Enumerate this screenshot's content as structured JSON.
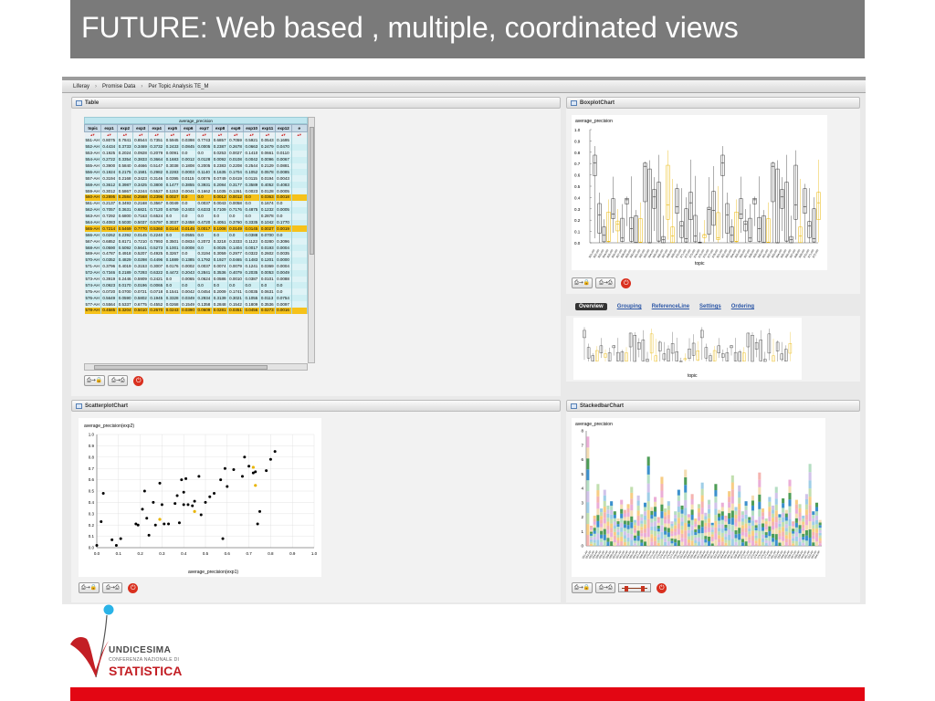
{
  "slide": {
    "title": "FUTURE: Web based , multiple, coordinated views"
  },
  "nav": {
    "breadcrumbs": [
      "Liferay",
      "Promise Data",
      "Per Topic Analysis TE_M"
    ]
  },
  "panels": {
    "table": "Table",
    "boxplot": "BoxplotChart",
    "scatter": "ScatterplotChart",
    "stacked": "StackedbarChart"
  },
  "toolbar": {
    "export_image": "⎙→🔒",
    "export_data": "⎙→⎙",
    "power": "⏻"
  },
  "table": {
    "group_header": "average_precision",
    "columns": [
      "topic",
      "exp1",
      "exp2",
      "exp3",
      "exp4",
      "exp5",
      "exp6",
      "exp7",
      "exp8",
      "exp9",
      "exp10",
      "exp11",
      "exp12",
      "e"
    ],
    "rows": [
      [
        "551-AH",
        "0.8075",
        "0.7841",
        "0.8544",
        "0.7351",
        "0.5945",
        "0.0398",
        "0.7743",
        "0.6857",
        "0.7059",
        "0.5921",
        "0.0543",
        "0.1695",
        ""
      ],
      [
        "552-AH",
        "0.4434",
        "0.3733",
        "0.3469",
        "0.3732",
        "0.2433",
        "0.0845",
        "0.0005",
        "0.2387",
        "0.2678",
        "0.0663",
        "0.2479",
        "0.0470",
        ""
      ],
      [
        "553-AH",
        "0.1925",
        "0.2024",
        "0.0928",
        "0.2079",
        "0.0091",
        "0.0",
        "0.0",
        "0.0253",
        "0.0027",
        "0.1410",
        "0.0661",
        "0.0110",
        ""
      ],
      [
        "554-AH",
        "0.2722",
        "0.3354",
        "0.3833",
        "0.3664",
        "0.1683",
        "0.0012",
        "0.0128",
        "0.0092",
        "0.0108",
        "0.0042",
        "0.0096",
        "0.0067",
        ""
      ],
      [
        "555-AH",
        "0.3900",
        "0.5840",
        "0.4666",
        "0.5147",
        "0.3038",
        "0.1808",
        "0.2005",
        "0.2383",
        "0.2208",
        "0.2544",
        "0.2129",
        "0.0881",
        ""
      ],
      [
        "556-AH",
        "0.1924",
        "0.2175",
        "0.1581",
        "0.2982",
        "0.2283",
        "0.0003",
        "0.1140",
        "0.1635",
        "0.1704",
        "0.1052",
        "0.0578",
        "0.0085",
        ""
      ],
      [
        "557-AH",
        "0.3194",
        "0.2168",
        "0.3423",
        "0.3146",
        "0.0395",
        "0.0115",
        "0.0076",
        "0.0749",
        "0.0419",
        "0.0115",
        "0.0194",
        "0.0043",
        ""
      ],
      [
        "558-AH",
        "0.3612",
        "0.3987",
        "0.3425",
        "0.3800",
        "0.1477",
        "0.3855",
        "0.3931",
        "0.2084",
        "0.3177",
        "0.3589",
        "0.4052",
        "0.4083",
        ""
      ],
      [
        "559-AH",
        "0.3012",
        "0.5867",
        "0.2244",
        "0.5527",
        "0.1153",
        "0.0041",
        "0.1662",
        "0.1035",
        "0.1261",
        "0.0023",
        "0.0128",
        "0.0005",
        ""
      ],
      [
        "560-AH",
        "0.2895",
        "0.2584",
        "0.2568",
        "0.2396",
        "0.0027",
        "0.0",
        "0.0",
        "0.0012",
        "0.0012",
        "0.0",
        "0.0363",
        "0.0018",
        ""
      ],
      [
        "561-AH",
        "0.2137",
        "0.3493",
        "0.2168",
        "0.3567",
        "0.0049",
        "0.0",
        "0.0037",
        "0.0043",
        "0.0058",
        "0.0",
        "0.1674",
        "0.0",
        ""
      ],
      [
        "562-AH",
        "0.7057",
        "0.3631",
        "0.6821",
        "0.7120",
        "0.6759",
        "0.2403",
        "0.6333",
        "0.7109",
        "0.7176",
        "0.4875",
        "0.1232",
        "0.0005",
        ""
      ],
      [
        "563-AH",
        "0.7292",
        "0.6800",
        "0.7163",
        "0.6524",
        "0.0",
        "0.0",
        "0.0",
        "0.0",
        "0.0",
        "0.0",
        "0.2878",
        "0.0",
        ""
      ],
      [
        "564-AH",
        "0.4083",
        "0.5030",
        "0.5037",
        "0.5797",
        "0.3037",
        "0.2458",
        "0.4720",
        "0.4051",
        "0.3760",
        "0.3335",
        "0.1042",
        "0.1770",
        ""
      ],
      [
        "565-AH",
        "0.7214",
        "0.5469",
        "0.7770",
        "0.5360",
        "0.0144",
        "0.0145",
        "0.0017",
        "0.1008",
        "0.0149",
        "0.0145",
        "0.0027",
        "0.0019",
        ""
      ],
      [
        "566-AH",
        "0.0262",
        "0.2392",
        "0.0145",
        "0.2240",
        "0.0",
        "0.0555",
        "0.0",
        "0.0",
        "0.0",
        "0.0388",
        "0.0700",
        "0.0",
        ""
      ],
      [
        "567-AH",
        "0.6852",
        "0.8171",
        "0.7210",
        "0.7993",
        "0.3501",
        "0.0834",
        "0.2072",
        "0.3218",
        "0.3333",
        "0.1123",
        "0.0280",
        "0.3096",
        ""
      ],
      [
        "568-AH",
        "0.0590",
        "0.5092",
        "0.5641",
        "0.5273",
        "0.1001",
        "0.0008",
        "0.0",
        "0.0025",
        "0.1404",
        "0.0017",
        "0.0193",
        "0.0004",
        ""
      ],
      [
        "569-AH",
        "0.4787",
        "0.4918",
        "0.5207",
        "0.4925",
        "0.3267",
        "0.0",
        "0.3194",
        "0.3059",
        "0.2977",
        "0.0322",
        "0.2602",
        "0.0035",
        ""
      ],
      [
        "570-AH",
        "0.0352",
        "0.4829",
        "0.0298",
        "0.4496",
        "0.1889",
        "0.1385",
        "0.1792",
        "0.1927",
        "0.0465",
        "0.1483",
        "0.1201",
        "0.0000",
        ""
      ],
      [
        "571-AH",
        "0.3796",
        "0.4019",
        "0.3153",
        "0.3007",
        "0.0176",
        "0.0002",
        "0.0037",
        "0.0074",
        "0.0079",
        "0.1241",
        "0.0369",
        "0.0004",
        ""
      ],
      [
        "572-AH",
        "0.7346",
        "0.2189",
        "0.7293",
        "0.6322",
        "0.4472",
        "0.2043",
        "0.2841",
        "0.3536",
        "0.4079",
        "0.2035",
        "0.0053",
        "0.0049",
        ""
      ],
      [
        "573-AH",
        "0.3919",
        "0.2446",
        "0.5909",
        "0.2421",
        "0.0",
        "0.0065",
        "0.0624",
        "0.0586",
        "0.0010",
        "0.0387",
        "0.0101",
        "0.0088",
        ""
      ],
      [
        "574-AH",
        "0.0923",
        "0.0170",
        "0.0196",
        "0.0065",
        "0.0",
        "0.0",
        "0.0",
        "0.0",
        "0.0",
        "0.0",
        "0.0",
        "0.0",
        ""
      ],
      [
        "575-AH",
        "0.0720",
        "0.0700",
        "0.0721",
        "0.0718",
        "0.1541",
        "0.0042",
        "0.0454",
        "0.2009",
        "0.1741",
        "0.0035",
        "0.0631",
        "0.0",
        ""
      ],
      [
        "576-AH",
        "0.5649",
        "0.0590",
        "0.5802",
        "0.1945",
        "0.3328",
        "0.0349",
        "0.2934",
        "0.3139",
        "0.3021",
        "0.1055",
        "0.0113",
        "0.0754",
        ""
      ],
      [
        "577-AH",
        "0.5564",
        "0.5337",
        "0.6775",
        "0.4552",
        "0.0268",
        "0.1549",
        "0.1358",
        "0.2848",
        "0.1542",
        "0.1809",
        "0.3536",
        "0.0097",
        ""
      ],
      [
        "578-AH",
        "0.4585",
        "0.3204",
        "0.5010",
        "0.2670",
        "0.0243",
        "0.0390",
        "0.0609",
        "0.0281",
        "0.0351",
        "0.0456",
        "0.0273",
        "0.0016",
        ""
      ]
    ],
    "highlight_rows": [
      9,
      14,
      27
    ]
  },
  "boxplot": {
    "ylabel": "average_precision",
    "xlabel": "topic",
    "yticks": [
      "1.0",
      "0.9",
      "0.8",
      "0.7",
      "0.6",
      "0.5",
      "0.4",
      "0.3",
      "0.2",
      "0.1",
      "0.0"
    ]
  },
  "overview": {
    "tabs": [
      "Overview",
      "Grouping",
      "ReferenceLine",
      "Settings",
      "Ordering"
    ],
    "xlabel": "topic"
  },
  "chart_data": [
    {
      "type": "scatter",
      "title": "",
      "xlabel": "average_precision(exp1)",
      "ylabel": "average_precision(exp2)",
      "xlim": [
        0,
        1.0
      ],
      "ylim": [
        0,
        1.0
      ],
      "xticks": [
        "0.0",
        "0.1",
        "0.2",
        "0.3",
        "0.4",
        "0.5",
        "0.6",
        "0.7",
        "0.8",
        "0.9",
        "1.0"
      ],
      "yticks": [
        "1.0",
        "0.9",
        "0.8",
        "0.7",
        "0.6",
        "0.5",
        "0.4",
        "0.3",
        "0.2",
        "0.1",
        "0.0"
      ],
      "grid": true,
      "points": [
        [
          0.0,
          0.02
        ],
        [
          0.02,
          0.23
        ],
        [
          0.03,
          0.48
        ],
        [
          0.07,
          0.07
        ],
        [
          0.09,
          0.02
        ],
        [
          0.11,
          0.08
        ],
        [
          0.18,
          0.21
        ],
        [
          0.19,
          0.2
        ],
        [
          0.21,
          0.34
        ],
        [
          0.22,
          0.5
        ],
        [
          0.23,
          0.26
        ],
        [
          0.24,
          0.11
        ],
        [
          0.26,
          0.4
        ],
        [
          0.27,
          0.2
        ],
        [
          0.29,
          0.57
        ],
        [
          0.3,
          0.38
        ],
        [
          0.31,
          0.21
        ],
        [
          0.33,
          0.21
        ],
        [
          0.36,
          0.39
        ],
        [
          0.37,
          0.46
        ],
        [
          0.38,
          0.22
        ],
        [
          0.39,
          0.6
        ],
        [
          0.4,
          0.49
        ],
        [
          0.4,
          0.38
        ],
        [
          0.41,
          0.61
        ],
        [
          0.42,
          0.38
        ],
        [
          0.44,
          0.37
        ],
        [
          0.45,
          0.41
        ],
        [
          0.47,
          0.63
        ],
        [
          0.48,
          0.29
        ],
        [
          0.5,
          0.4
        ],
        [
          0.52,
          0.45
        ],
        [
          0.54,
          0.48
        ],
        [
          0.57,
          0.6
        ],
        [
          0.58,
          0.08
        ],
        [
          0.59,
          0.7
        ],
        [
          0.6,
          0.54
        ],
        [
          0.63,
          0.69
        ],
        [
          0.67,
          0.63
        ],
        [
          0.68,
          0.8
        ],
        [
          0.7,
          0.72
        ],
        [
          0.72,
          0.66
        ],
        [
          0.73,
          0.67
        ],
        [
          0.74,
          0.21
        ],
        [
          0.75,
          0.32
        ],
        [
          0.78,
          0.68
        ],
        [
          0.8,
          0.78
        ],
        [
          0.82,
          0.85
        ]
      ],
      "highlight_points": [
        [
          0.29,
          0.25
        ],
        [
          0.45,
          0.32
        ],
        [
          0.72,
          0.71
        ],
        [
          0.73,
          0.55
        ]
      ],
      "colors": {
        "point": "#000000",
        "highlight": "#e8b400"
      }
    },
    {
      "type": "bar",
      "title": "",
      "ylabel": "average_precision",
      "ylim": [
        0,
        8
      ],
      "yticks": [
        "8",
        "7",
        "6",
        "5",
        "4",
        "3",
        "2",
        "1",
        "0"
      ],
      "stacked": true,
      "totals": [
        7.6,
        1.4,
        2.1,
        4.3,
        2.6,
        3.9,
        2.8,
        3.1,
        2.4,
        1.9,
        3.2,
        2.5,
        2.9,
        4.1,
        1.8,
        3.5,
        2.2,
        3.0,
        6.2,
        2.7,
        3.4,
        2.0,
        4.8,
        2.6,
        3.1,
        1.7,
        2.4,
        3.9,
        2.8,
        5.3,
        2.2,
        3.6,
        1.9,
        2.9,
        4.4,
        2.3,
        3.2,
        1.6,
        4.3,
        2.5,
        3.0,
        2.1,
        3.8,
        4.9,
        2.7,
        4.2,
        2.4,
        3.1,
        2.0,
        3.5,
        1.8,
        5.1,
        2.6,
        1.9,
        3.4,
        2.8,
        4.1,
        2.2,
        3.3,
        2.5,
        4.6,
        1.7,
        3.2,
        2.9,
        2.1,
        3.6,
        5.7,
        2.4,
        3.0,
        1.8
      ],
      "colors": [
        "#f3a7a2",
        "#f6c46f",
        "#b7d9a1",
        "#8ec6e3",
        "#c9b8e6",
        "#a8d8b9",
        "#1a7dc4",
        "#2f8c3a",
        "#f2d7a6",
        "#e7a0d0"
      ]
    }
  ],
  "logo": {
    "line1": "UNDICESIMA",
    "line2": "CONFERENZA NAZIONALE DI",
    "line3": "STATISTICA"
  }
}
